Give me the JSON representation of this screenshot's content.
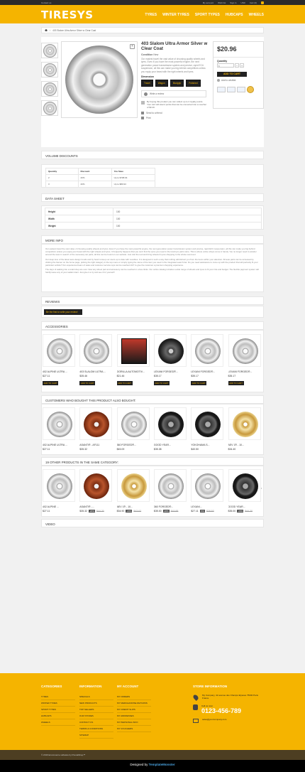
{
  "topbar": {
    "contact": "Contact us",
    "right_links": [
      "My account",
      "Wish list",
      "Sign in"
    ],
    "currency": "USD",
    "cart_label": "Cart (0)"
  },
  "header": {
    "logo": "TIRESYS",
    "nav": [
      "TYRES",
      "WINTER TYRES",
      "SPORT TYPES",
      "HUBCAPS",
      "WHEELS"
    ]
  },
  "breadcrumb": {
    "path": "403 Slalom Ultra Armor Silver w Clear Coat"
  },
  "product": {
    "title": "403 Slalom Ultra Armor Silver w Clear Coat",
    "condition_label": "Condition",
    "condition_value": "New",
    "description": "Our easiest travel the vast value of choosing quality wheels and tyres. Even if you have the most powerful engine, the next generation power transmission system and precise, rapid ECU suspension, all this can make you big behind competitors unless you equip your beast with the right wheels and tyres.",
    "dimension_label": "Dimension",
    "dimensions": [
      "Travel",
      "Wagon",
      "Mudgrip",
      "Polished"
    ],
    "review_label": "Write a review",
    "loyalty_text": "By buying this product you can collect up to 2 loyalty points. Your cart will total 2 points that can be converted into a voucher of $0.40.",
    "send_friend": "Send to a friend",
    "print": "Print",
    "price": "$20.96",
    "quantity_label": "Quantity",
    "quantity_value": "1",
    "add_to_cart": "ADD TO CART",
    "wishlist": "Add to wishlist"
  },
  "volume_discounts": {
    "title": "Volume discounts",
    "headers": [
      "Quantity",
      "Discount",
      "You Save"
    ],
    "rows": [
      [
        "2",
        "20%",
        "Up to $798.94"
      ],
      [
        "3",
        "20%",
        "Up to $80.93"
      ]
    ]
  },
  "data_sheet": {
    "title": "Data sheet",
    "rows": [
      [
        "Height",
        "100"
      ],
      [
        "Width",
        "100"
      ],
      [
        "Weight",
        "100"
      ]
    ]
  },
  "more_info": {
    "title": "More info",
    "paragraphs": [
      "Our easiest travel the vast value of choosing quality wheels and tyres. Even if you have the most powerful engine, the next generation power transmission system and precise, rapid ECU suspension, all this can make you big behind competitors unless you equip your beast with the right wheels and tyres. It frequently happens that you can't find the tyres you need in the local tyre parts store. This is where online shops come in handy. You no longer need to wander around the town in search of the necessary car parts, all this can be found on our website. Just visit the tool and bring wheels & tyres shopping to the whole new level.",
      "Our deep love of the latest auto design trends and by hand to keep our users up to date with novelties. It is designed in such a way that nothing will distract you from the items within your attention. All auto parts can be accessed by clicking the banner on the home page, picking the right category in the top menu or simply typing the name of the item you need in the integrated search bar. Do you need assistance to come up with the product that will perfectly fit your particular vehicle? Our experienced team of sales and customer service reps can be reached 24/7 to give the customer a premium shopping experience.",
      "The days of walking into a retail shop are over. Now any wheel part and accessory can be reached in a few clicks. Our online catalog includes a wide range of wheels and tyres to fit your ride and budget. The flexible payment system will hardly leave any of your wallet intact. Just give it a try and see it for yourself!"
    ]
  },
  "reviews": {
    "title": "Reviews",
    "button": "Be the first to write your review!"
  },
  "accessories": {
    "title": "Accessories",
    "items": [
      {
        "name": "402 ALPINE ULTRA ...",
        "price": "$27.11",
        "button": "ADD TO CART",
        "style": "silver"
      },
      {
        "name": "403 SLALOM ULTRA ...",
        "price": "$35.46",
        "button": "ADD TO CART",
        "style": "silver"
      },
      {
        "name": "GORILLA AUTOMOTIV...",
        "price": "$21.46",
        "button": "ADD TO CART",
        "style": "box"
      },
      {
        "name": "LEXANI FORGED®...",
        "price": "$35.17",
        "button": "ADD TO CART",
        "style": "dark"
      },
      {
        "name": "LEXANI FORGED®...",
        "price": "$35.17",
        "button": "ADD TO CART",
        "style": "silver"
      },
      {
        "name": "LEXANI FORGED®...",
        "price": "$35.17",
        "button": "ADD TO CART",
        "style": "silver"
      }
    ]
  },
  "also_bought": {
    "title": "Customers who bought this product also bought:",
    "items": [
      {
        "name": "402 ALPINE ULTRA ...",
        "price": "$27.11",
        "style": "silver"
      },
      {
        "name": "ASANTI® - AF111",
        "price": "$35.32",
        "style": "bronze"
      },
      {
        "name": "360 FORGED®...",
        "price": "$45.09",
        "style": "silver"
      },
      {
        "name": "GOOD YEAR...",
        "price": "$35.38",
        "style": "tire"
      },
      {
        "name": "YOKOHAMA S...",
        "price": "$40.50",
        "style": "tire"
      },
      {
        "name": "AEV 1® - 10...",
        "price": "$34.40",
        "style": "gold"
      }
    ]
  },
  "same_category": {
    "title": "19 other products in the same category:",
    "items": [
      {
        "name": "402 ALPINE ...",
        "price": "$27.11",
        "pct": "",
        "old": "",
        "style": "silver"
      },
      {
        "name": "ASANTI® -...",
        "price": "$35.32",
        "pct": "-20%",
        "old": "$44.20",
        "style": "bronze"
      },
      {
        "name": "AEV 1® - 10...",
        "price": "$34.90",
        "pct": "-20%",
        "old": "$43.62",
        "style": "gold"
      },
      {
        "name": "360 FORGED®...",
        "price": "$35.00",
        "pct": "-20%",
        "old": "$43.88",
        "style": "silver"
      },
      {
        "name": "LEXANI...",
        "price": "$27.11",
        "pct": "-5%",
        "old": "$28.53",
        "style": "silver"
      },
      {
        "name": "GOOD YEAR...",
        "price": "$35.00",
        "pct": "-20%",
        "old": "$44.20",
        "style": "tire"
      }
    ]
  },
  "video": {
    "title": "Video"
  },
  "footer": {
    "categories_title": "Categories",
    "categories": [
      "Tyres",
      "Winter tyres",
      "Sport types",
      "Hubcaps",
      "Wheels"
    ],
    "information_title": "Information",
    "information": [
      "Specials",
      "New products",
      "Top sellers",
      "Our stores",
      "Contact us",
      "Terms & conditions",
      "Sitemap"
    ],
    "account_title": "My account",
    "account": [
      "My orders",
      "My merchandise returns",
      "My credit slips",
      "My addresses",
      "My personal info",
      "My vouchers"
    ],
    "store_title": "Store information",
    "address": "My Company, 42 avenue des Champs Elysées 75000 Paris France",
    "call_label": "Call us now:",
    "phone": "0123-456-789",
    "email": "sales@yourcompany.com"
  },
  "copyright": "© 2016 Ecommerce software by PrestaShop™",
  "designed_by": {
    "prefix": "Designed by",
    "brand": "TemplateMonster"
  },
  "colors": {
    "accent": "#f5b400",
    "dark": "#222222",
    "footer_bottom": "#4d3e22"
  }
}
